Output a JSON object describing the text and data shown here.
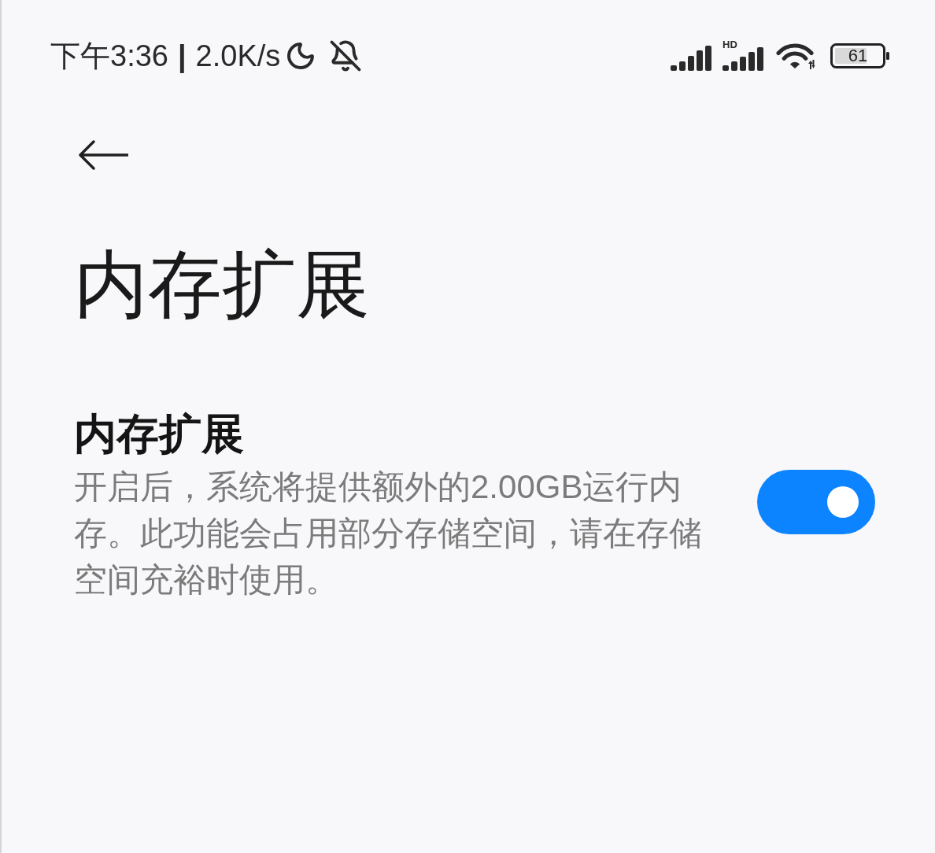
{
  "status_bar": {
    "time": "下午3:36",
    "separator": "|",
    "net_speed": "2.0K/s",
    "network_label": "HD",
    "battery": "61"
  },
  "header": {
    "title": "内存扩展"
  },
  "settings": [
    {
      "kind": "toggle",
      "title": "内存扩展",
      "description": "开启后，系统将提供额外的2.00GB运行内存。此功能会占用部分存储空间，请在存储空间充裕时使用。",
      "on": true
    }
  ]
}
